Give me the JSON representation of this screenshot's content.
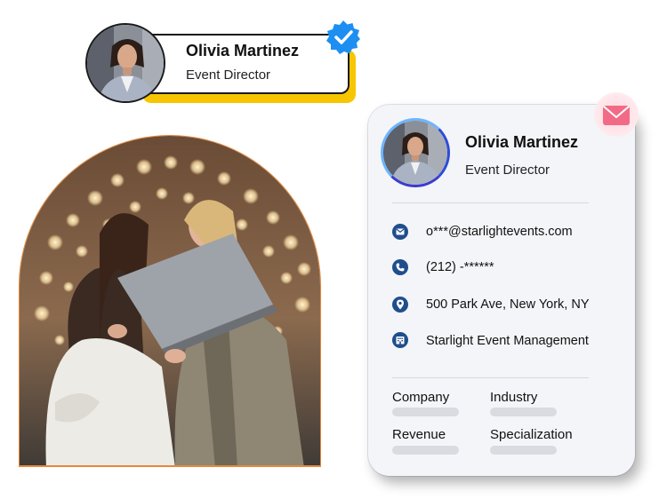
{
  "badge": {
    "name": "Olivia Martinez",
    "role": "Event Director"
  },
  "card": {
    "name": "Olivia Martinez",
    "role": "Event Director",
    "contacts": [
      {
        "icon": "email-icon",
        "text": "o***@starlightevents.com"
      },
      {
        "icon": "phone-icon",
        "text": "(212) -******"
      },
      {
        "icon": "location-pin-icon",
        "text": "500 Park Ave, New York, NY"
      },
      {
        "icon": "building-icon",
        "text": "Starlight Event Management"
      }
    ],
    "fields": [
      {
        "label": "Company"
      },
      {
        "label": "Industry"
      },
      {
        "label": "Revenue"
      },
      {
        "label": "Specialization"
      }
    ]
  },
  "colors": {
    "accent_yellow": "#f7c600",
    "verified_blue": "#1d8ff2",
    "icon_navy": "#1f4e8c",
    "arch_border": "#e6893a",
    "mail_pink": "#f26b86"
  }
}
